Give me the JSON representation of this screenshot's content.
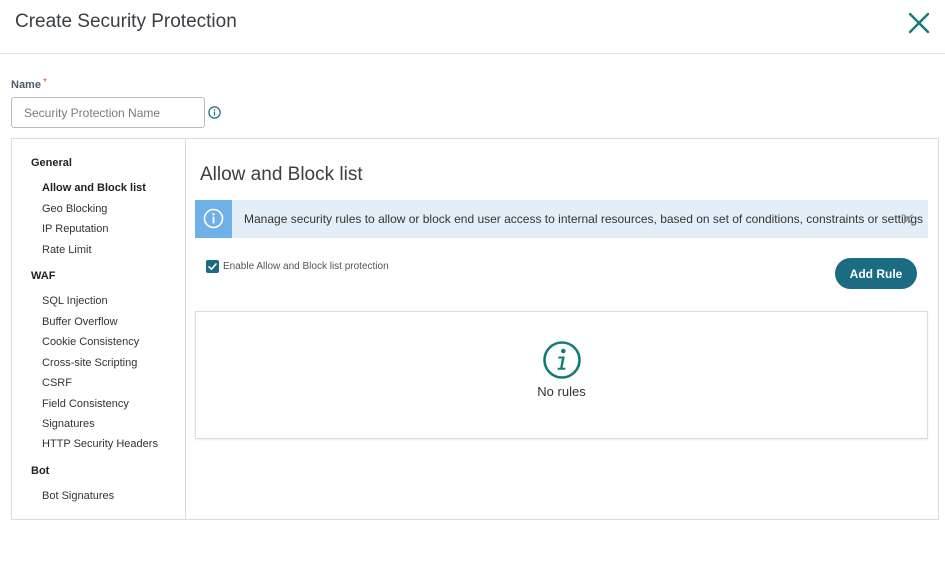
{
  "header": {
    "title": "Create Security Protection"
  },
  "name_field": {
    "label": "Name",
    "required_mark": "*",
    "placeholder": "Security Protection Name",
    "value": ""
  },
  "sidebar": {
    "sections": [
      {
        "title": "General",
        "items": [
          {
            "label": "Allow and Block list",
            "active": true
          },
          {
            "label": "Geo Blocking"
          },
          {
            "label": "IP Reputation"
          },
          {
            "label": "Rate Limit"
          }
        ]
      },
      {
        "title": "WAF",
        "items": [
          {
            "label": "SQL Injection"
          },
          {
            "label": "Buffer Overflow"
          },
          {
            "label": "Cookie Consistency"
          },
          {
            "label": "Cross-site Scripting"
          },
          {
            "label": "CSRF"
          },
          {
            "label": "Field Consistency"
          },
          {
            "label": "Signatures"
          },
          {
            "label": "HTTP Security Headers"
          }
        ]
      },
      {
        "title": "Bot",
        "items": [
          {
            "label": "Bot Signatures"
          }
        ]
      }
    ]
  },
  "content": {
    "title": "Allow and Block list",
    "banner": {
      "text": "Manage security rules to allow or block end user access to internal resources, based on set of conditions, constraints or settings",
      "icon": "info-icon"
    },
    "enable_checkbox": {
      "label": "Enable Allow and Block list protection",
      "checked": true
    },
    "add_rule_label": "Add Rule",
    "empty_state": {
      "text": "No rules",
      "icon": "info-icon"
    }
  },
  "colors": {
    "accent": "#1b6b82",
    "close_icon": "#137c74",
    "banner_bg": "#e4eef9",
    "banner_icon_bg": "#6fb0e6",
    "required": "#d9534f"
  }
}
